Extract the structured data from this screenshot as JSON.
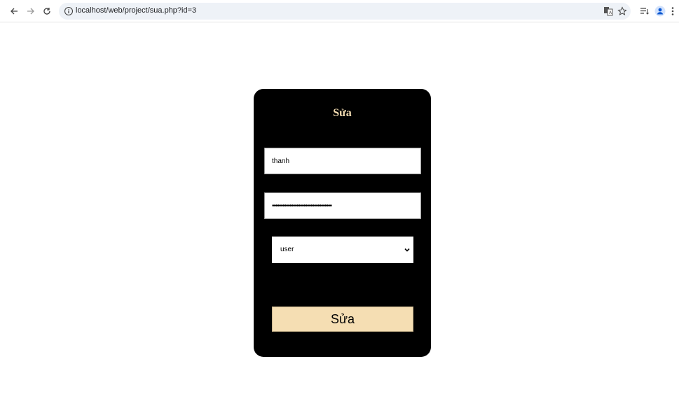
{
  "browser": {
    "url": "localhost/web/project/sua.php?id=3",
    "icons": [
      "back-icon",
      "forward-icon",
      "reload-icon",
      "site-info-icon",
      "translate-icon",
      "bookmark-star-icon",
      "reading-list-icon",
      "profile-icon",
      "menu-icon"
    ]
  },
  "form": {
    "title": "Sửa",
    "username_value": "thanh",
    "password_value": "••••••••••••••••••••••••••••••••••",
    "role_selected": "user",
    "submit_label": "Sửa"
  },
  "colors": {
    "card_bg": "#000000",
    "accent": "#f5deb3"
  }
}
